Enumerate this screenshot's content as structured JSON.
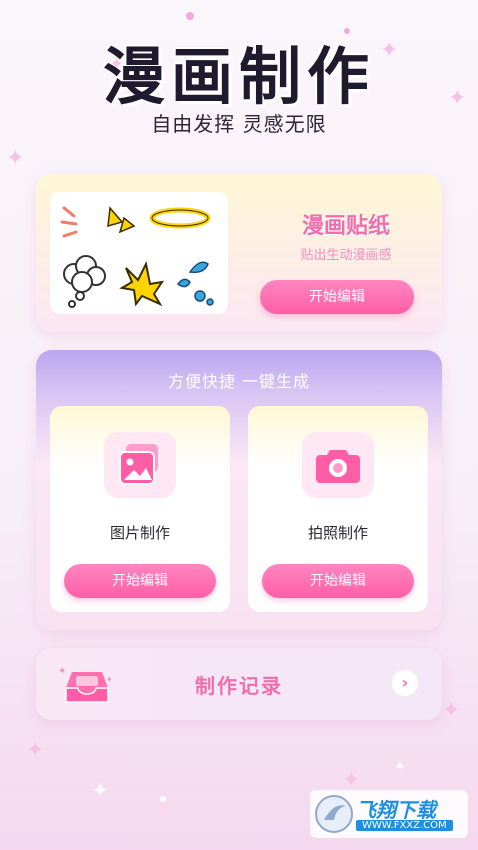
{
  "header": {
    "title": "漫画制作",
    "subtitle": "自由发挥 灵感无限"
  },
  "sticker_card": {
    "title": "漫画贴纸",
    "description": "贴出生动漫画感",
    "button_label": "开始编辑"
  },
  "quick_card": {
    "title": "方便快捷 一键生成",
    "options": [
      {
        "label": "图片制作",
        "button_label": "开始编辑",
        "icon": "gallery-icon"
      },
      {
        "label": "拍照制作",
        "button_label": "开始编辑",
        "icon": "camera-icon"
      }
    ]
  },
  "record": {
    "label": "制作记录",
    "icon": "inbox-tray-icon"
  },
  "watermark": {
    "text": "飞翔下载",
    "url": "WWW.FXXZ.COM"
  },
  "colors": {
    "accent_pink": "#ff5ea7",
    "title_pink": "#ef6fae",
    "purple": "#b9a6ef",
    "title_dark": "#1f1a2e"
  }
}
